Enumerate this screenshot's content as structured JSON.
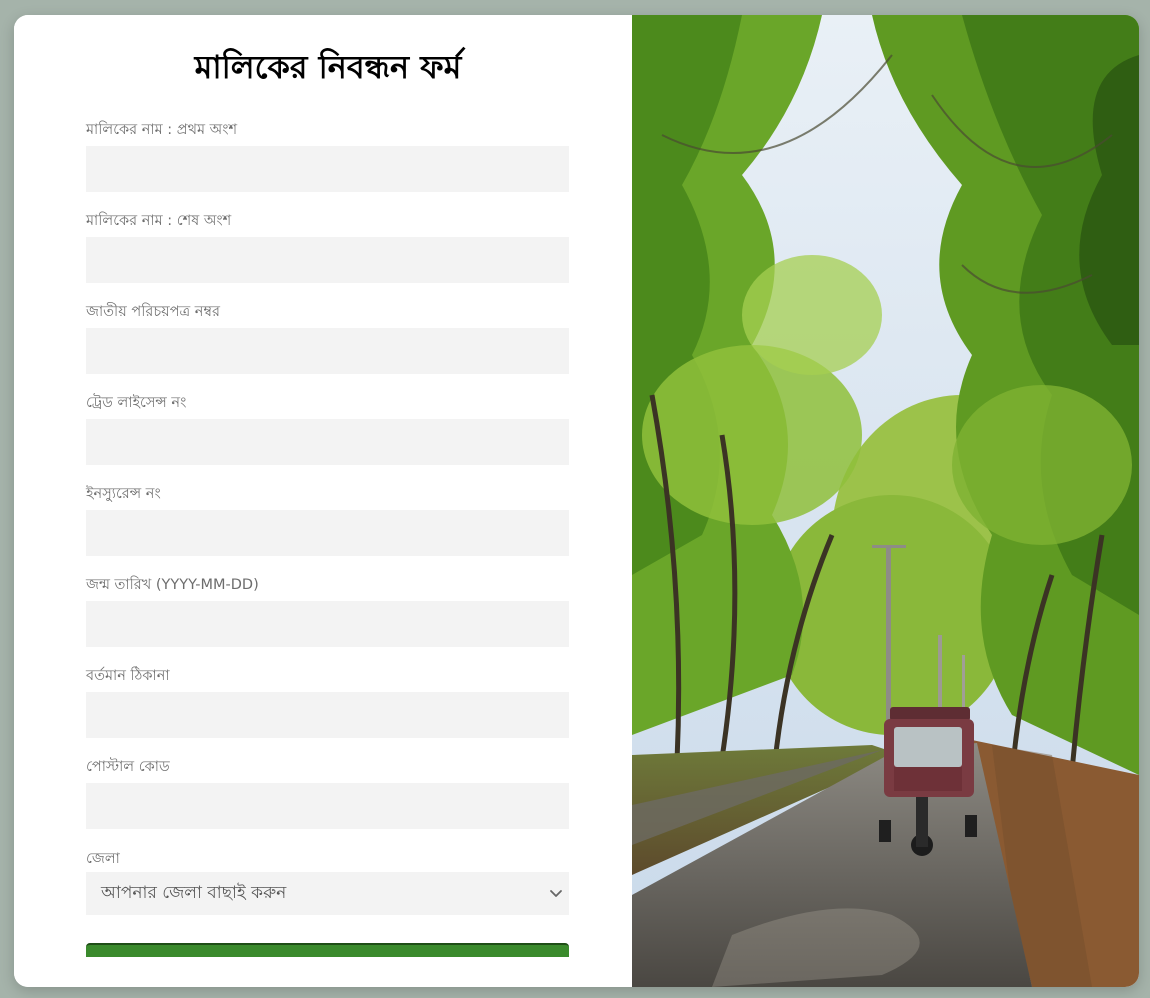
{
  "form": {
    "title": "মালিকের নিবন্ধন ফর্ম",
    "fields": [
      {
        "label": "মালিকের নাম : প্রথম অংশ",
        "value": ""
      },
      {
        "label": "মালিকের নাম : শেষ অংশ",
        "value": ""
      },
      {
        "label": "জাতীয় পরিচয়পত্র নম্বর",
        "value": ""
      },
      {
        "label": "ট্রেড লাইসেন্স নং",
        "value": ""
      },
      {
        "label": "ইনস্যুরেন্স নং",
        "value": ""
      },
      {
        "label": "জন্ম তারিখ (YYYY-MM-DD)",
        "value": ""
      },
      {
        "label": "বর্তমান ঠিকানা",
        "value": ""
      },
      {
        "label": "পোস্টাল কোড",
        "value": ""
      }
    ],
    "district": {
      "label": "জেলা",
      "selected": "আপনার জেলা বাছাই করুন",
      "icon": "chevron-down-icon"
    },
    "submit": {
      "label": ""
    }
  },
  "colors": {
    "page_background": "#a5b3aa",
    "card_background": "#ffffff",
    "input_background": "#f3f3f3",
    "label_color": "#6d6d6d",
    "title_color": "#000000",
    "submit_color": "#3a8a2c"
  },
  "image": {
    "subject": "tree-lined road with auto-rickshaw"
  }
}
